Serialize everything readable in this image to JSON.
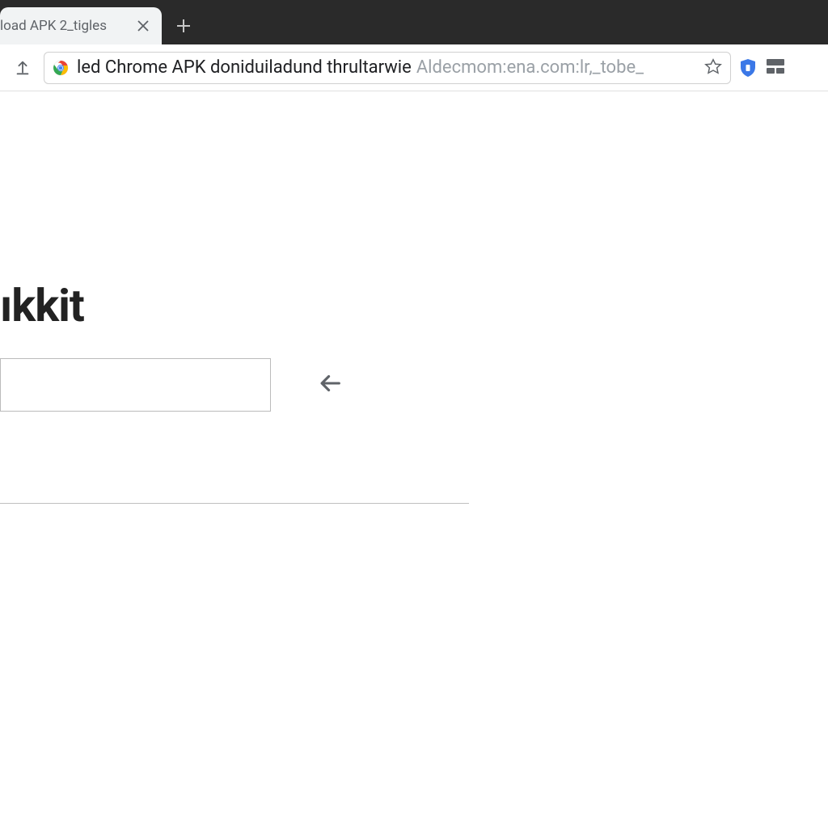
{
  "tabStrip": {
    "tab": {
      "title": "load APK 2_tigles"
    }
  },
  "toolbar": {
    "url": {
      "primary": "led Chrome APK doniduiladund thrultarwie",
      "secondary": "Aldecmom:ena.com:lr,_tobe_"
    }
  },
  "content": {
    "heading": "ıkkit",
    "inputValue": ""
  }
}
